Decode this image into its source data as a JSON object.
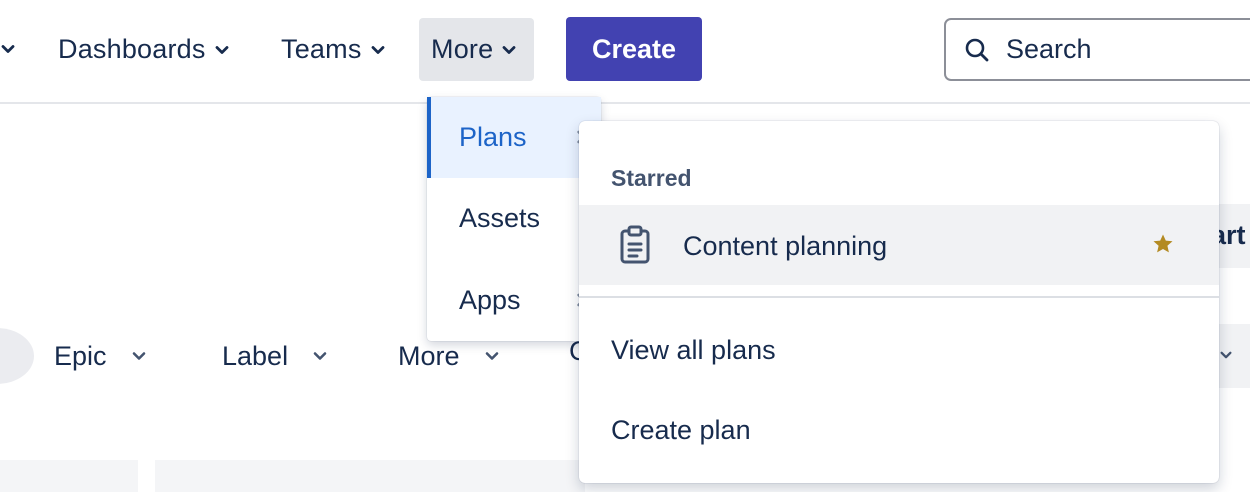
{
  "nav": {
    "items": [
      {
        "label": "Dashboards"
      },
      {
        "label": "Teams"
      },
      {
        "label": "More"
      }
    ],
    "create_label": "Create",
    "search_placeholder": "Search"
  },
  "more_menu": {
    "items": [
      {
        "label": "Plans",
        "selected": true
      },
      {
        "label": "Assets"
      },
      {
        "label": "Apps"
      }
    ]
  },
  "plans_flyout": {
    "starred_heading": "Starred",
    "starred_plans": [
      {
        "name": "Content planning",
        "icon": "clipboard-icon",
        "starred": true
      }
    ],
    "view_all_label": "View all plans",
    "create_label": "Create plan"
  },
  "filters": [
    {
      "label": "Epic"
    },
    {
      "label": "Label"
    },
    {
      "label": "More"
    }
  ],
  "filter_partial": "C",
  "partial_button": "art",
  "colors": {
    "primary": "#4242b1",
    "selected_text": "#1d64c8",
    "selected_bg": "#e9f2ff",
    "star": "#b38a22",
    "text": "#172b4d"
  }
}
